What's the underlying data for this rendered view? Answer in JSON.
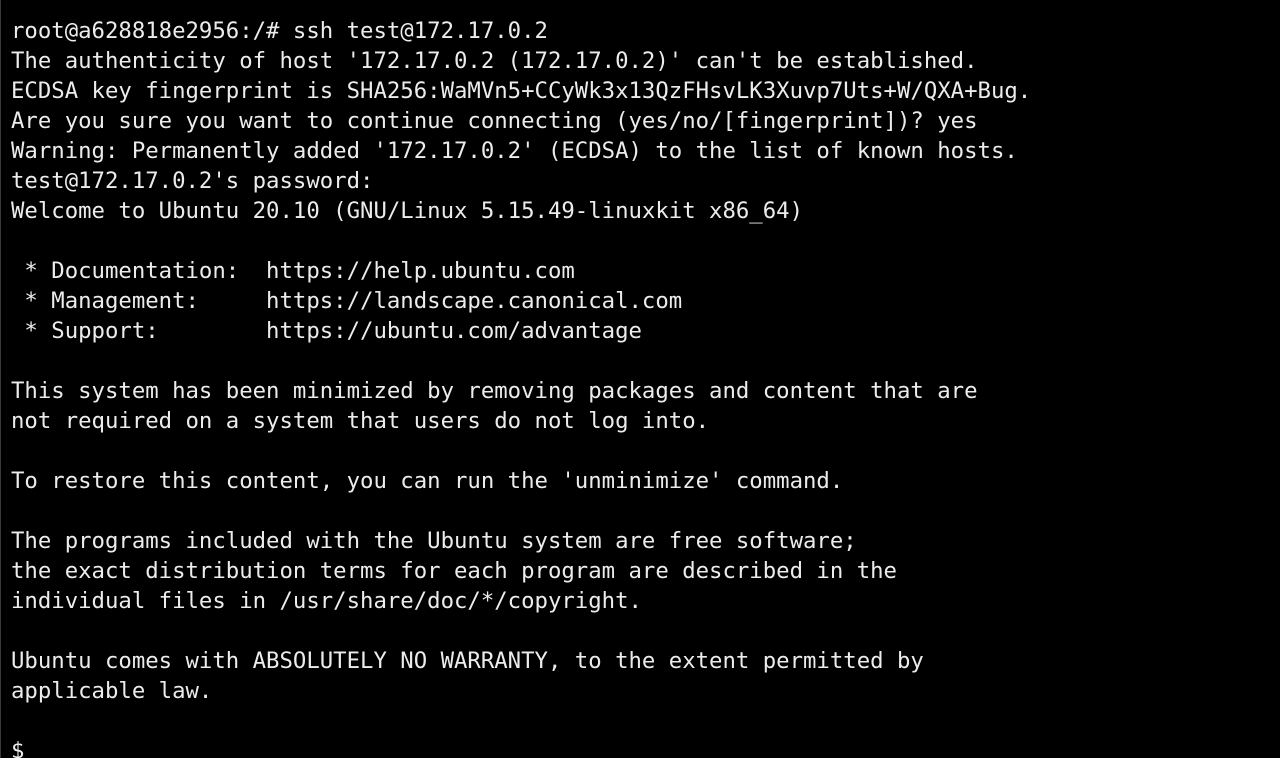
{
  "terminal": {
    "lines": [
      "root@a628818e2956:/# ssh test@172.17.0.2",
      "The authenticity of host '172.17.0.2 (172.17.0.2)' can't be established.",
      "ECDSA key fingerprint is SHA256:WaMVn5+CCyWk3x13QzFHsvLK3Xuvp7Uts+W/QXA+Bug.",
      "Are you sure you want to continue connecting (yes/no/[fingerprint])? yes",
      "Warning: Permanently added '172.17.0.2' (ECDSA) to the list of known hosts.",
      "test@172.17.0.2's password:",
      "Welcome to Ubuntu 20.10 (GNU/Linux 5.15.49-linuxkit x86_64)",
      "",
      " * Documentation:  https://help.ubuntu.com",
      " * Management:     https://landscape.canonical.com",
      " * Support:        https://ubuntu.com/advantage",
      "",
      "This system has been minimized by removing packages and content that are",
      "not required on a system that users do not log into.",
      "",
      "To restore this content, you can run the 'unminimize' command.",
      "",
      "The programs included with the Ubuntu system are free software;",
      "the exact distribution terms for each program are described in the",
      "individual files in /usr/share/doc/*/copyright.",
      "",
      "Ubuntu comes with ABSOLUTELY NO WARRANTY, to the extent permitted by",
      "applicable law.",
      ""
    ],
    "prompt": "$"
  },
  "colors": {
    "background": "#000000",
    "foreground": "#ececec"
  }
}
